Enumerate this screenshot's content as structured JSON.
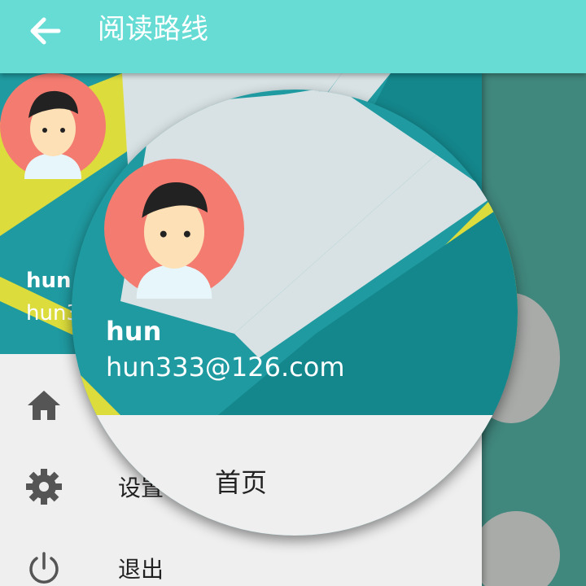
{
  "app": {
    "title": "阅读路线",
    "back_icon": "arrow-left-icon",
    "appbar_color": "#66dcd4"
  },
  "drawer": {
    "user": {
      "name": "hun",
      "email_partial": "hun3",
      "avatar_icon": "user-avatar"
    },
    "menu": [
      {
        "label": "首页",
        "icon": "home-icon"
      },
      {
        "label": "设置",
        "icon": "gear-icon"
      },
      {
        "label": "退出",
        "icon": "power-icon"
      }
    ]
  },
  "magnifier": {
    "name": "hun",
    "email": "hun333@126.com",
    "highlight_label": "首页"
  },
  "colors": {
    "header_teal": "#1f9aa0",
    "accent_yellow": "#dcdd3c",
    "background_dark_teal": "#40877d"
  }
}
